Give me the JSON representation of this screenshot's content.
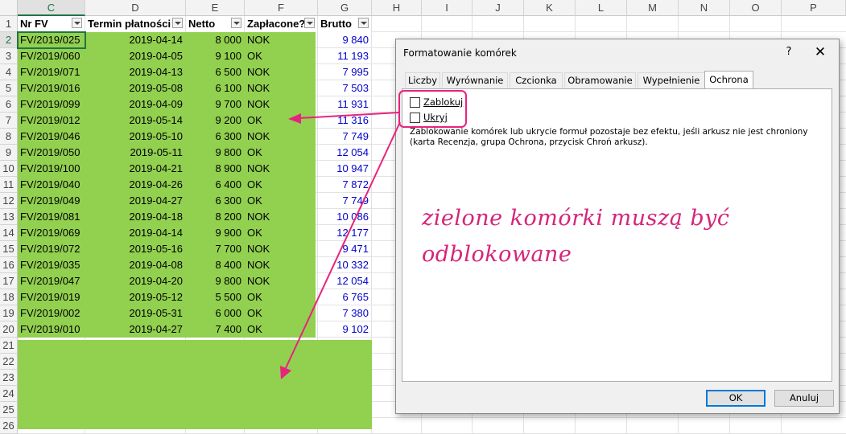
{
  "sheet": {
    "columns": [
      "C",
      "D",
      "E",
      "F",
      "G",
      "H",
      "I",
      "J",
      "K",
      "L",
      "M",
      "N",
      "O",
      "P"
    ],
    "rows": [
      "1",
      "2",
      "3",
      "4",
      "5",
      "6",
      "7",
      "8",
      "9",
      "10",
      "11",
      "12",
      "13",
      "14",
      "15",
      "16",
      "17",
      "18",
      "19",
      "20",
      "21",
      "22",
      "23",
      "24",
      "25",
      "26"
    ],
    "headers": {
      "nr": "Nr FV",
      "termin": "Termin płatności",
      "netto": "Netto",
      "zaplacone": "Zapłacone?",
      "brutto": "Brutto"
    },
    "data": [
      [
        "FV/2019/025",
        "2019-04-14",
        "8 000",
        "NOK",
        "9 840"
      ],
      [
        "FV/2019/060",
        "2019-04-05",
        "9 100",
        "OK",
        "11 193"
      ],
      [
        "FV/2019/071",
        "2019-04-13",
        "6 500",
        "NOK",
        "7 995"
      ],
      [
        "FV/2019/016",
        "2019-05-08",
        "6 100",
        "NOK",
        "7 503"
      ],
      [
        "FV/2019/099",
        "2019-04-09",
        "9 700",
        "NOK",
        "11 931"
      ],
      [
        "FV/2019/012",
        "2019-05-14",
        "9 200",
        "OK",
        "11 316"
      ],
      [
        "FV/2019/046",
        "2019-05-10",
        "6 300",
        "NOK",
        "7 749"
      ],
      [
        "FV/2019/050",
        "2019-05-11",
        "9 800",
        "OK",
        "12 054"
      ],
      [
        "FV/2019/100",
        "2019-04-21",
        "8 900",
        "NOK",
        "10 947"
      ],
      [
        "FV/2019/040",
        "2019-04-26",
        "6 400",
        "OK",
        "7 872"
      ],
      [
        "FV/2019/049",
        "2019-04-27",
        "6 300",
        "OK",
        "7 749"
      ],
      [
        "FV/2019/081",
        "2019-04-18",
        "8 200",
        "NOK",
        "10 086"
      ],
      [
        "FV/2019/069",
        "2019-04-14",
        "9 900",
        "OK",
        "12 177"
      ],
      [
        "FV/2019/072",
        "2019-05-16",
        "7 700",
        "NOK",
        "9 471"
      ],
      [
        "FV/2019/035",
        "2019-04-08",
        "8 400",
        "NOK",
        "10 332"
      ],
      [
        "FV/2019/047",
        "2019-04-20",
        "9 800",
        "NOK",
        "12 054"
      ],
      [
        "FV/2019/019",
        "2019-05-12",
        "5 500",
        "OK",
        "6 765"
      ],
      [
        "FV/2019/002",
        "2019-05-31",
        "6 000",
        "OK",
        "7 380"
      ],
      [
        "FV/2019/010",
        "2019-04-27",
        "7 400",
        "OK",
        "9 102"
      ]
    ],
    "fill_color": "#92d050",
    "brutto_color": "#0000cc"
  },
  "dialog": {
    "title": "Formatowanie komórek",
    "help": "?",
    "close": "✕",
    "tabs": [
      "Liczby",
      "Wyrównanie",
      "Czcionka",
      "Obramowanie",
      "Wypełnienie",
      "Ochrona"
    ],
    "active_tab": "Ochrona",
    "lock_label": "Zablokuj",
    "hide_label": "Ukryj",
    "info": "Zablokowanie komórek lub ukrycie formuł pozostaje bez efektu, jeśli arkusz nie jest chroniony (karta Recenzja, grupa Ochrona, przycisk Chroń arkusz).",
    "ok_label": "OK",
    "cancel_label": "Anuluj"
  },
  "annotation": {
    "line1": "zielone komórki muszą być",
    "line2": "odblokowane",
    "color": "#e8237d"
  }
}
